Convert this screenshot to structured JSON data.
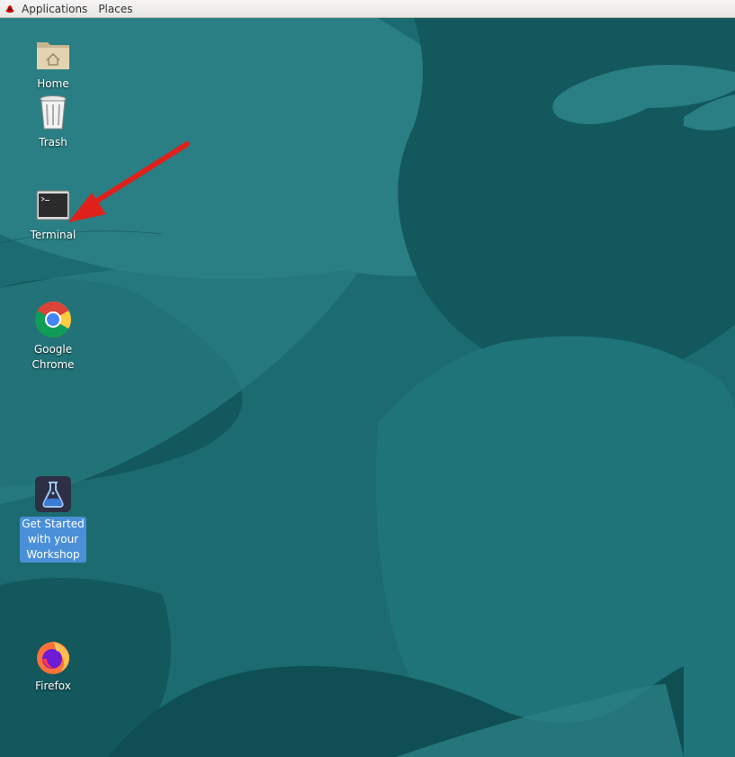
{
  "topbar": {
    "applications_label": "Applications",
    "places_label": "Places"
  },
  "desktop": {
    "icons": [
      {
        "label": "Home"
      },
      {
        "label": "Trash"
      },
      {
        "label": "Terminal"
      },
      {
        "label": "Google\nChrome"
      },
      {
        "label": "Get Started\nwith your\nWorkshop",
        "selected": true
      },
      {
        "label": "Firefox"
      }
    ]
  },
  "colors": {
    "wallpaper_base": "#1b6b70",
    "wallpaper_dark": "#12585d",
    "wallpaper_light": "#2a7f84",
    "annotation_arrow": "#e0201b",
    "selection": "#4a90d9"
  }
}
